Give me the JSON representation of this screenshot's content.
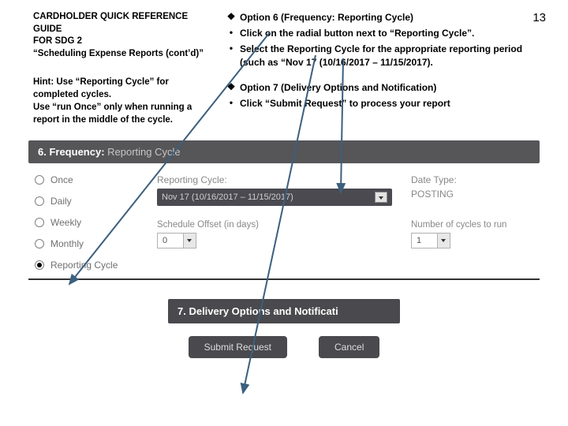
{
  "page_number": "13",
  "left": {
    "line1": "CARDHOLDER QUICK REFERENCE GUIDE",
    "line2": "FOR SDG 2",
    "line3": "“Scheduling Expense Reports (cont’d)”",
    "hint": "Hint: Use “Reporting Cycle” for completed cycles.\nUse “run Once” only when running a report in the middle of the cycle."
  },
  "right": {
    "items": [
      {
        "marker": "❖",
        "text": "Option 6 (Frequency: Reporting Cycle)",
        "bold": true
      },
      {
        "marker": "•",
        "text": "Click on the radial button next to “Reporting Cycle”.",
        "bold": true
      },
      {
        "marker": "•",
        "text": "Select the Reporting Cycle for the appropriate reporting period (such as “Nov 17 (10/16/2017 – 11/15/2017).",
        "bold": true
      },
      {
        "marker": "",
        "text": "",
        "bold": false
      },
      {
        "marker": "❖",
        "text": "Option 7 (Delivery Options and Notification)",
        "bold": true
      },
      {
        "marker": "•",
        "text": "Click “Submit Request” to process your report",
        "bold": true
      }
    ]
  },
  "section6": {
    "title_prefix": "6. Frequency: ",
    "title_rest": "Reporting Cycle",
    "radios": [
      "Once",
      "Daily",
      "Weekly",
      "Monthly",
      "Reporting Cycle"
    ],
    "selected_radio": 4,
    "rc_label": "Reporting Cycle:",
    "rc_value": "Nov 17 (10/16/2017 – 11/15/2017)",
    "offset_label": "Schedule Offset (in days)",
    "offset_value": "0",
    "date_type_label": "Date Type:",
    "date_type_value": "POSTING",
    "cycles_label": "Number of cycles to run",
    "cycles_value": "1"
  },
  "section7": {
    "title": "7. Delivery Options and Notificati"
  },
  "buttons": {
    "submit": "Submit Request",
    "cancel": "Cancel"
  }
}
